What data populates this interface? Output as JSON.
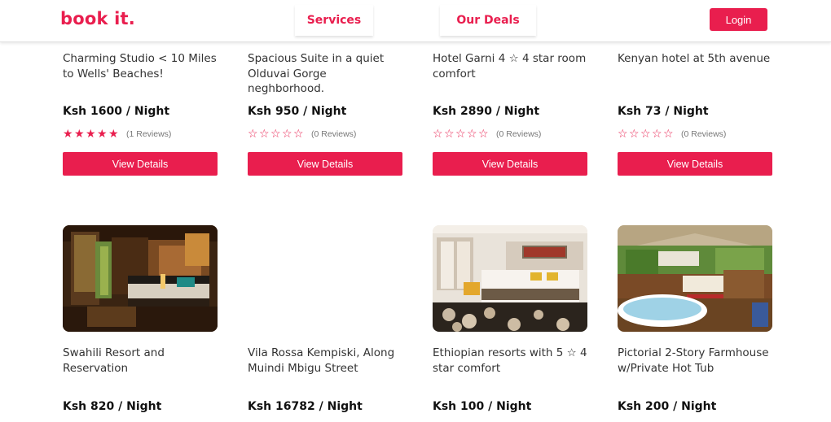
{
  "header": {
    "logo": "book it.",
    "nav": {
      "services": "Services",
      "deals": "Our Deals"
    },
    "login": "Login"
  },
  "cards_row1": [
    {
      "title": "Charming Studio < 10 Miles to Wells' Beaches!",
      "price": "Ksh 1600",
      "per": " / Night",
      "rating": 5,
      "reviews": "(1 Reviews)",
      "button": "View Details"
    },
    {
      "title": "Spacious Suite in a quiet Olduvai Gorge neghborhood.",
      "price": "Ksh 950",
      "per": " / Night",
      "rating": 0,
      "reviews": "(0 Reviews)",
      "button": "View Details"
    },
    {
      "title": "Hotel Garni 4 ☆ 4 star room comfort",
      "price": "Ksh 2890",
      "per": " / Night",
      "rating": 0,
      "reviews": "(0 Reviews)",
      "button": "View Details"
    },
    {
      "title": "Kenyan hotel at 5th avenue",
      "price": "Ksh 73",
      "per": " / Night",
      "rating": 0,
      "reviews": "(0 Reviews)",
      "button": "View Details"
    }
  ],
  "cards_row2": [
    {
      "title": "Swahili Resort and Reservation",
      "price": "Ksh 820",
      "per": " / Night",
      "image": "hotel-room-dark-wood"
    },
    {
      "title": "Vila Rossa Kempiski, Along Muindi Mbigu Street",
      "price": "Ksh 16782",
      "per": " / Night",
      "image": ""
    },
    {
      "title": "Ethiopian resorts with 5 ☆ 4 star comfort",
      "price": "Ksh 100",
      "per": " / Night",
      "image": "hotel-room-modern"
    },
    {
      "title": "Pictorial 2-Story Farmhouse w/Private Hot Tub",
      "price": "Ksh 200",
      "per": " / Night",
      "image": "safari-tent-bathtub"
    }
  ],
  "colors": {
    "accent": "#e91e4e"
  }
}
